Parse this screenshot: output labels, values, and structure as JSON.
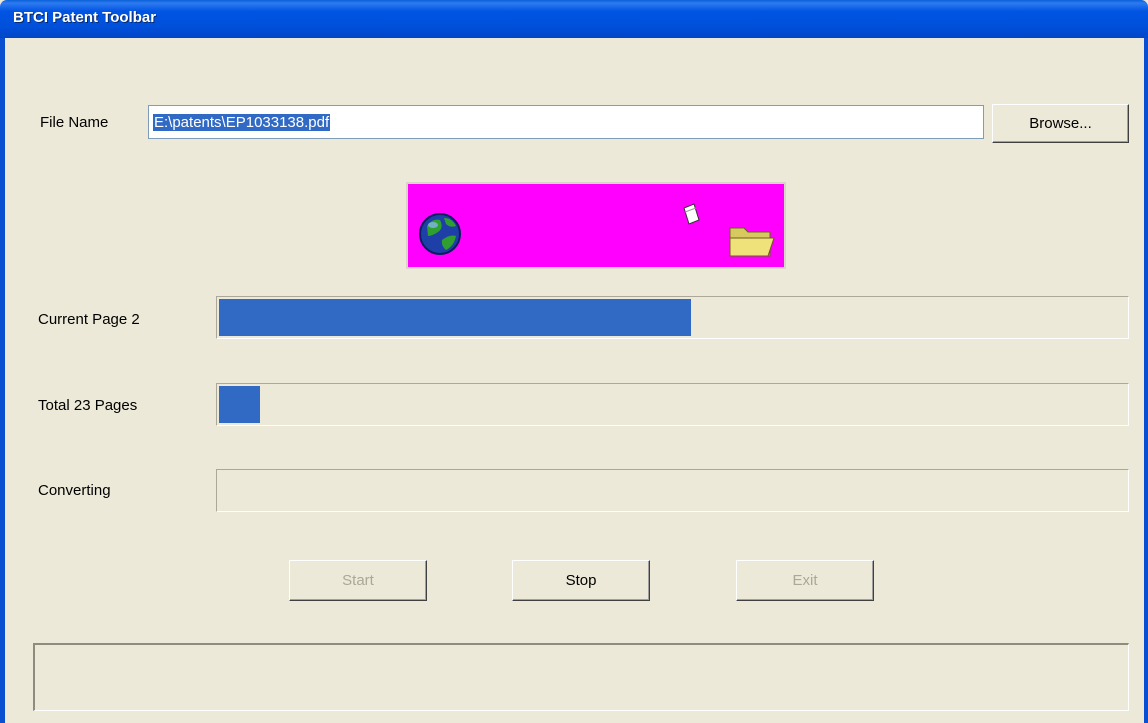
{
  "window": {
    "title": "BTCI Patent Toolbar"
  },
  "file": {
    "label": "File Name",
    "value": "E:\\patents\\EP1033138.pdf",
    "browse_label": "Browse..."
  },
  "animation": {
    "icons": [
      "globe-icon",
      "paper-sheet-icon",
      "folder-icon"
    ],
    "background": "#FF00FF"
  },
  "progress": {
    "current_page": {
      "label": "Current Page 2",
      "fraction": 0.52
    },
    "total_pages": {
      "label": "Total 23 Pages",
      "fraction": 0.045
    },
    "converting": {
      "label": "Converting",
      "fraction": 0
    }
  },
  "buttons": {
    "start": "Start",
    "stop": "Stop",
    "exit": "Exit"
  },
  "status": {
    "text": ""
  },
  "colors": {
    "titlebar": "#0054E3",
    "progress_fill": "#316AC5",
    "dialog_bg": "#ECE9D8"
  }
}
